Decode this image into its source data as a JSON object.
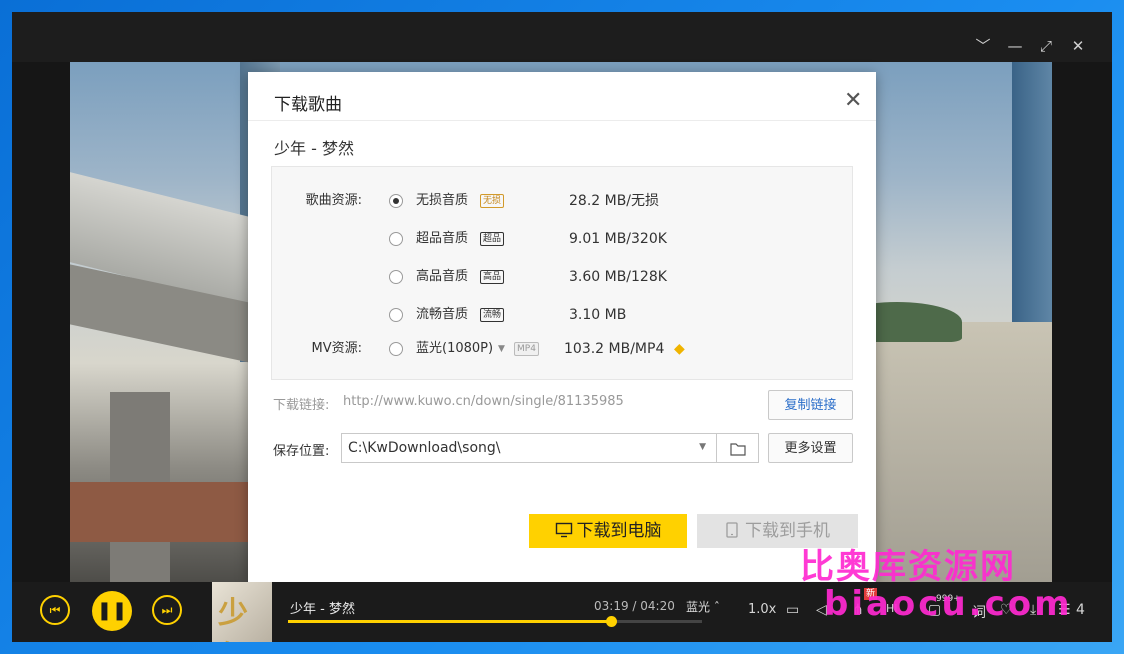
{
  "window": {
    "controls": [
      "﹀",
      "—",
      "⤢",
      "✕"
    ]
  },
  "dialog": {
    "title": "下载歌曲",
    "close": "✕",
    "song": "少年 - 梦然",
    "song_source_label": "歌曲资源:",
    "mv_source_label": "MV资源:",
    "qualities": [
      {
        "name": "无损音质",
        "badge": "无损",
        "size": "28.2 MB/无损",
        "selected": true
      },
      {
        "name": "超品音质",
        "badge": "超品",
        "size": "9.01 MB/320K",
        "selected": false
      },
      {
        "name": "高品音质",
        "badge": "高品",
        "size": "3.60 MB/128K",
        "selected": false
      },
      {
        "name": "流畅音质",
        "badge": "流畅",
        "size": "3.10 MB",
        "selected": false
      }
    ],
    "mv": {
      "name": "蓝光(1080P)",
      "badge": "MP4",
      "size": "103.2 MB/MP4",
      "selected": false
    },
    "link_label": "下载链接:",
    "link_url": "http://www.kuwo.cn/down/single/81135985",
    "copy_link": "复制链接",
    "save_label": "保存位置:",
    "save_path": "C:\\KwDownload\\song\\",
    "more_settings": "更多设置",
    "download_pc": "下载到电脑",
    "download_phone": "下载到手机"
  },
  "player": {
    "title": "少年 - 梦然",
    "time": "03:19 / 04:20",
    "quality": "蓝光",
    "progress": 0.78,
    "speed": "1.0x",
    "new_badge": "新",
    "count_badge": "999+",
    "playlist_count": "4",
    "cover_text": "少年"
  },
  "watermark": {
    "line1": "比奥库资源网",
    "line2": "biaocu.com"
  },
  "colors": {
    "accent": "#ffd100",
    "link_blue": "#2b6ec9",
    "watermark": "#ff2ad1"
  }
}
